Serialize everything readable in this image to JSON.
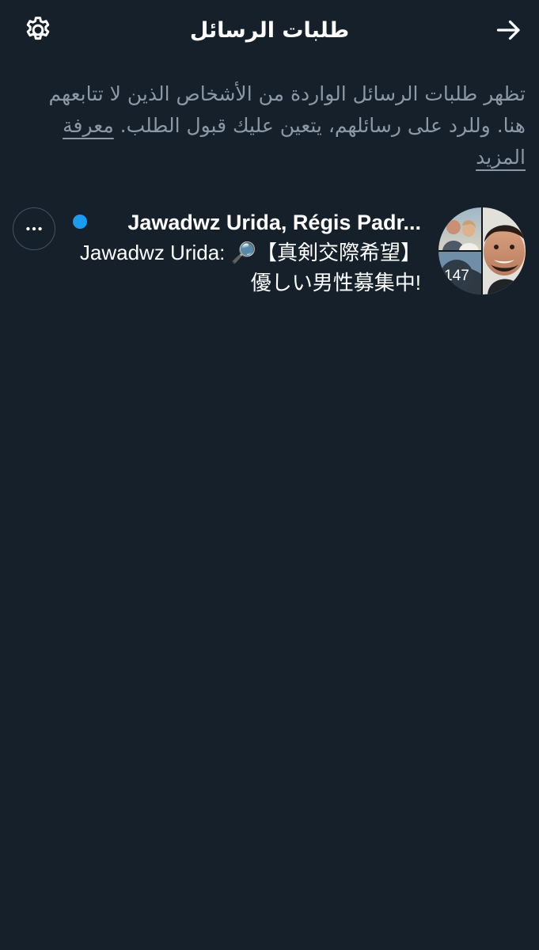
{
  "header": {
    "title": "طلبات الرسائل",
    "settings_icon": "gear-icon",
    "back_icon": "arrow-right-icon"
  },
  "description": {
    "text": "تظهر طلبات الرسائل الواردة من الأشخاص الذين لا تتابعهم هنا. وللرد على رسائلهم، يتعين عليك قبول الطلب. ",
    "learn_more": "معرفة المزيد"
  },
  "requests": [
    {
      "participants": "Jawadwz Urida, Régis Padr...",
      "preview": "Jawadwz Urida: 🔎【真剣交際希望】優しい男性募集中!",
      "count": "147",
      "unread": true,
      "more_icon": "more-horizontal-icon"
    }
  ],
  "colors": {
    "background": "#15202b",
    "accent": "#1d9bf0",
    "secondary_text": "#8b98a5"
  }
}
